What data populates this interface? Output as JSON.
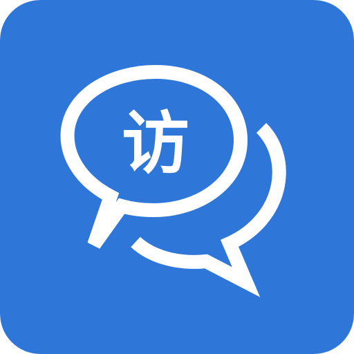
{
  "app_icon": {
    "glyph": "访",
    "icon_name": "chat-bubbles-icon",
    "colors": {
      "background": "#2F76D9",
      "foreground": "#FFFFFF"
    }
  }
}
